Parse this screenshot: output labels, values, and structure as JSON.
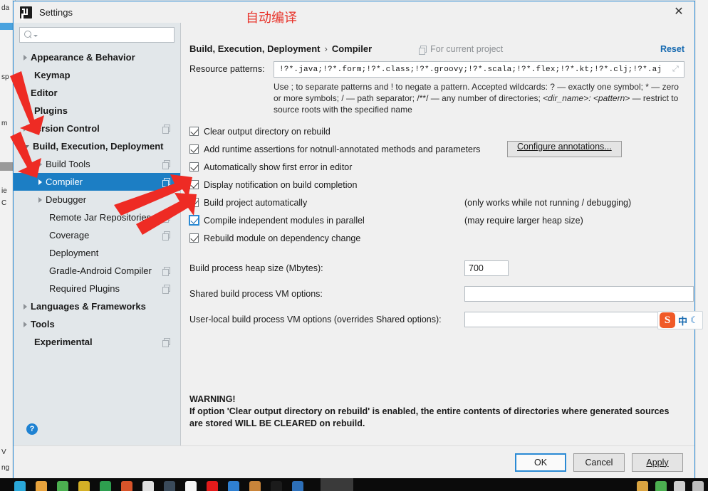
{
  "window": {
    "title": "Settings",
    "close_label": "✕",
    "logo_name": "intellij-idea-logo"
  },
  "annotation": {
    "text": "自动编译",
    "color": "#e8332a"
  },
  "search": {
    "value": "",
    "placeholder": ""
  },
  "sidebar": {
    "items": [
      {
        "label": "Appearance & Behavior",
        "arrow": "right",
        "bold": true,
        "indent": 0,
        "copy": false,
        "selected": false
      },
      {
        "label": "Keymap",
        "arrow": "none",
        "bold": true,
        "indent": 0,
        "copy": false,
        "selected": false
      },
      {
        "label": "Editor",
        "arrow": "right",
        "bold": true,
        "indent": 0,
        "copy": false,
        "selected": false
      },
      {
        "label": "Plugins",
        "arrow": "none",
        "bold": true,
        "indent": 0,
        "copy": false,
        "selected": false
      },
      {
        "label": "Version Control",
        "arrow": "right",
        "bold": true,
        "indent": 0,
        "copy": true,
        "selected": false
      },
      {
        "label": "Build, Execution, Deployment",
        "arrow": "down",
        "bold": true,
        "indent": 0,
        "copy": false,
        "selected": false
      },
      {
        "label": "Build Tools",
        "arrow": "right",
        "bold": false,
        "indent": 1,
        "copy": true,
        "selected": false
      },
      {
        "label": "Compiler",
        "arrow": "right",
        "bold": false,
        "indent": 1,
        "copy": true,
        "selected": true
      },
      {
        "label": "Debugger",
        "arrow": "right",
        "bold": false,
        "indent": 1,
        "copy": false,
        "selected": false
      },
      {
        "label": "Remote Jar Repositories",
        "arrow": "none",
        "bold": false,
        "indent": 1,
        "copy": true,
        "selected": false
      },
      {
        "label": "Coverage",
        "arrow": "none",
        "bold": false,
        "indent": 1,
        "copy": true,
        "selected": false
      },
      {
        "label": "Deployment",
        "arrow": "none",
        "bold": false,
        "indent": 1,
        "copy": false,
        "selected": false
      },
      {
        "label": "Gradle-Android Compiler",
        "arrow": "none",
        "bold": false,
        "indent": 1,
        "copy": true,
        "selected": false
      },
      {
        "label": "Required Plugins",
        "arrow": "none",
        "bold": false,
        "indent": 1,
        "copy": true,
        "selected": false
      },
      {
        "label": "Languages & Frameworks",
        "arrow": "right",
        "bold": true,
        "indent": 0,
        "copy": false,
        "selected": false
      },
      {
        "label": "Tools",
        "arrow": "right",
        "bold": true,
        "indent": 0,
        "copy": false,
        "selected": false
      },
      {
        "label": "Experimental",
        "arrow": "none",
        "bold": true,
        "indent": 0,
        "copy": true,
        "selected": false
      }
    ],
    "help_label": "?"
  },
  "header": {
    "breadcrumb_root": "Build, Execution, Deployment",
    "breadcrumb_sep": "›",
    "breadcrumb_leaf": "Compiler",
    "scope_label": "For current project",
    "reset_label": "Reset"
  },
  "resource": {
    "label": "Resource patterns:",
    "value": "!?*.java;!?*.form;!?*.class;!?*.groovy;!?*.scala;!?*.flex;!?*.kt;!?*.clj;!?*.aj",
    "expand_icon": "⤢",
    "hint_line1": "Use ; to separate patterns and ! to negate a pattern. Accepted wildcards: ? — exactly one symbol; * — zero or",
    "hint_line2_a": "more symbols; / — path separator; /**/ — any number of directories; ",
    "hint_line2_i": "<dir_name>: <pattern>",
    "hint_line2_b": " — restrict to",
    "hint_line3": "source roots with the specified name"
  },
  "checkboxes": [
    {
      "label": "Clear output directory on rebuild",
      "checked": true,
      "focus": false,
      "note": ""
    },
    {
      "label": "Add runtime assertions for notnull-annotated methods and parameters",
      "checked": true,
      "focus": false,
      "note": ""
    },
    {
      "label": "Automatically show first error in editor",
      "checked": true,
      "focus": false,
      "note": ""
    },
    {
      "label": "Display notification on build completion",
      "checked": true,
      "focus": false,
      "note": ""
    },
    {
      "label": "Build project automatically",
      "checked": true,
      "focus": false,
      "note": "(only works while not running / debugging)"
    },
    {
      "label": "Compile independent modules in parallel",
      "checked": true,
      "focus": true,
      "note": "(may require larger heap size)"
    },
    {
      "label": "Rebuild module on dependency change",
      "checked": true,
      "focus": false,
      "note": ""
    }
  ],
  "annotations_button": {
    "label": "Configure annotations..."
  },
  "fields": [
    {
      "label": "Build process heap size (Mbytes):",
      "value": "700",
      "wide": false
    },
    {
      "label": "Shared build process VM options:",
      "value": "",
      "wide": true
    },
    {
      "label": "User-local build process VM options (overrides Shared options):",
      "value": "",
      "wide": true
    }
  ],
  "warning": {
    "line1": "WARNING!",
    "line2": "If option 'Clear output directory on rebuild' is enabled, the entire contents of directories where generated sources",
    "line3": "are stored WILL BE CLEARED on rebuild."
  },
  "footer": {
    "ok": "OK",
    "cancel": "Cancel",
    "apply": "Apply"
  },
  "ime": {
    "logo": "S",
    "mode": "中",
    "moon": "☾"
  },
  "background": {
    "fragments": [
      "da",
      "sp",
      "m",
      "ie",
      "C",
      "V",
      "ng"
    ]
  }
}
